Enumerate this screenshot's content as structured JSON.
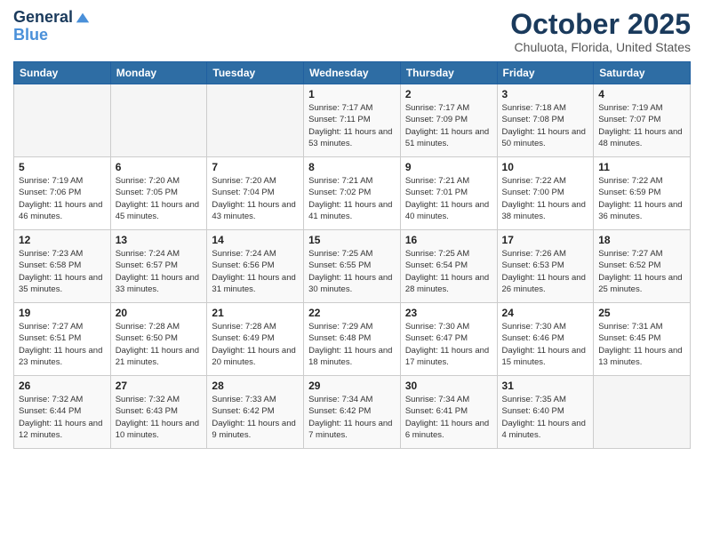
{
  "header": {
    "logo_line1": "General",
    "logo_line2": "Blue",
    "title": "October 2025",
    "subtitle": "Chuluota, Florida, United States"
  },
  "weekdays": [
    "Sunday",
    "Monday",
    "Tuesday",
    "Wednesday",
    "Thursday",
    "Friday",
    "Saturday"
  ],
  "weeks": [
    [
      {
        "day": "",
        "sunrise": "",
        "sunset": "",
        "daylight": ""
      },
      {
        "day": "",
        "sunrise": "",
        "sunset": "",
        "daylight": ""
      },
      {
        "day": "",
        "sunrise": "",
        "sunset": "",
        "daylight": ""
      },
      {
        "day": "1",
        "sunrise": "Sunrise: 7:17 AM",
        "sunset": "Sunset: 7:11 PM",
        "daylight": "Daylight: 11 hours and 53 minutes."
      },
      {
        "day": "2",
        "sunrise": "Sunrise: 7:17 AM",
        "sunset": "Sunset: 7:09 PM",
        "daylight": "Daylight: 11 hours and 51 minutes."
      },
      {
        "day": "3",
        "sunrise": "Sunrise: 7:18 AM",
        "sunset": "Sunset: 7:08 PM",
        "daylight": "Daylight: 11 hours and 50 minutes."
      },
      {
        "day": "4",
        "sunrise": "Sunrise: 7:19 AM",
        "sunset": "Sunset: 7:07 PM",
        "daylight": "Daylight: 11 hours and 48 minutes."
      }
    ],
    [
      {
        "day": "5",
        "sunrise": "Sunrise: 7:19 AM",
        "sunset": "Sunset: 7:06 PM",
        "daylight": "Daylight: 11 hours and 46 minutes."
      },
      {
        "day": "6",
        "sunrise": "Sunrise: 7:20 AM",
        "sunset": "Sunset: 7:05 PM",
        "daylight": "Daylight: 11 hours and 45 minutes."
      },
      {
        "day": "7",
        "sunrise": "Sunrise: 7:20 AM",
        "sunset": "Sunset: 7:04 PM",
        "daylight": "Daylight: 11 hours and 43 minutes."
      },
      {
        "day": "8",
        "sunrise": "Sunrise: 7:21 AM",
        "sunset": "Sunset: 7:02 PM",
        "daylight": "Daylight: 11 hours and 41 minutes."
      },
      {
        "day": "9",
        "sunrise": "Sunrise: 7:21 AM",
        "sunset": "Sunset: 7:01 PM",
        "daylight": "Daylight: 11 hours and 40 minutes."
      },
      {
        "day": "10",
        "sunrise": "Sunrise: 7:22 AM",
        "sunset": "Sunset: 7:00 PM",
        "daylight": "Daylight: 11 hours and 38 minutes."
      },
      {
        "day": "11",
        "sunrise": "Sunrise: 7:22 AM",
        "sunset": "Sunset: 6:59 PM",
        "daylight": "Daylight: 11 hours and 36 minutes."
      }
    ],
    [
      {
        "day": "12",
        "sunrise": "Sunrise: 7:23 AM",
        "sunset": "Sunset: 6:58 PM",
        "daylight": "Daylight: 11 hours and 35 minutes."
      },
      {
        "day": "13",
        "sunrise": "Sunrise: 7:24 AM",
        "sunset": "Sunset: 6:57 PM",
        "daylight": "Daylight: 11 hours and 33 minutes."
      },
      {
        "day": "14",
        "sunrise": "Sunrise: 7:24 AM",
        "sunset": "Sunset: 6:56 PM",
        "daylight": "Daylight: 11 hours and 31 minutes."
      },
      {
        "day": "15",
        "sunrise": "Sunrise: 7:25 AM",
        "sunset": "Sunset: 6:55 PM",
        "daylight": "Daylight: 11 hours and 30 minutes."
      },
      {
        "day": "16",
        "sunrise": "Sunrise: 7:25 AM",
        "sunset": "Sunset: 6:54 PM",
        "daylight": "Daylight: 11 hours and 28 minutes."
      },
      {
        "day": "17",
        "sunrise": "Sunrise: 7:26 AM",
        "sunset": "Sunset: 6:53 PM",
        "daylight": "Daylight: 11 hours and 26 minutes."
      },
      {
        "day": "18",
        "sunrise": "Sunrise: 7:27 AM",
        "sunset": "Sunset: 6:52 PM",
        "daylight": "Daylight: 11 hours and 25 minutes."
      }
    ],
    [
      {
        "day": "19",
        "sunrise": "Sunrise: 7:27 AM",
        "sunset": "Sunset: 6:51 PM",
        "daylight": "Daylight: 11 hours and 23 minutes."
      },
      {
        "day": "20",
        "sunrise": "Sunrise: 7:28 AM",
        "sunset": "Sunset: 6:50 PM",
        "daylight": "Daylight: 11 hours and 21 minutes."
      },
      {
        "day": "21",
        "sunrise": "Sunrise: 7:28 AM",
        "sunset": "Sunset: 6:49 PM",
        "daylight": "Daylight: 11 hours and 20 minutes."
      },
      {
        "day": "22",
        "sunrise": "Sunrise: 7:29 AM",
        "sunset": "Sunset: 6:48 PM",
        "daylight": "Daylight: 11 hours and 18 minutes."
      },
      {
        "day": "23",
        "sunrise": "Sunrise: 7:30 AM",
        "sunset": "Sunset: 6:47 PM",
        "daylight": "Daylight: 11 hours and 17 minutes."
      },
      {
        "day": "24",
        "sunrise": "Sunrise: 7:30 AM",
        "sunset": "Sunset: 6:46 PM",
        "daylight": "Daylight: 11 hours and 15 minutes."
      },
      {
        "day": "25",
        "sunrise": "Sunrise: 7:31 AM",
        "sunset": "Sunset: 6:45 PM",
        "daylight": "Daylight: 11 hours and 13 minutes."
      }
    ],
    [
      {
        "day": "26",
        "sunrise": "Sunrise: 7:32 AM",
        "sunset": "Sunset: 6:44 PM",
        "daylight": "Daylight: 11 hours and 12 minutes."
      },
      {
        "day": "27",
        "sunrise": "Sunrise: 7:32 AM",
        "sunset": "Sunset: 6:43 PM",
        "daylight": "Daylight: 11 hours and 10 minutes."
      },
      {
        "day": "28",
        "sunrise": "Sunrise: 7:33 AM",
        "sunset": "Sunset: 6:42 PM",
        "daylight": "Daylight: 11 hours and 9 minutes."
      },
      {
        "day": "29",
        "sunrise": "Sunrise: 7:34 AM",
        "sunset": "Sunset: 6:42 PM",
        "daylight": "Daylight: 11 hours and 7 minutes."
      },
      {
        "day": "30",
        "sunrise": "Sunrise: 7:34 AM",
        "sunset": "Sunset: 6:41 PM",
        "daylight": "Daylight: 11 hours and 6 minutes."
      },
      {
        "day": "31",
        "sunrise": "Sunrise: 7:35 AM",
        "sunset": "Sunset: 6:40 PM",
        "daylight": "Daylight: 11 hours and 4 minutes."
      },
      {
        "day": "",
        "sunrise": "",
        "sunset": "",
        "daylight": ""
      }
    ]
  ]
}
